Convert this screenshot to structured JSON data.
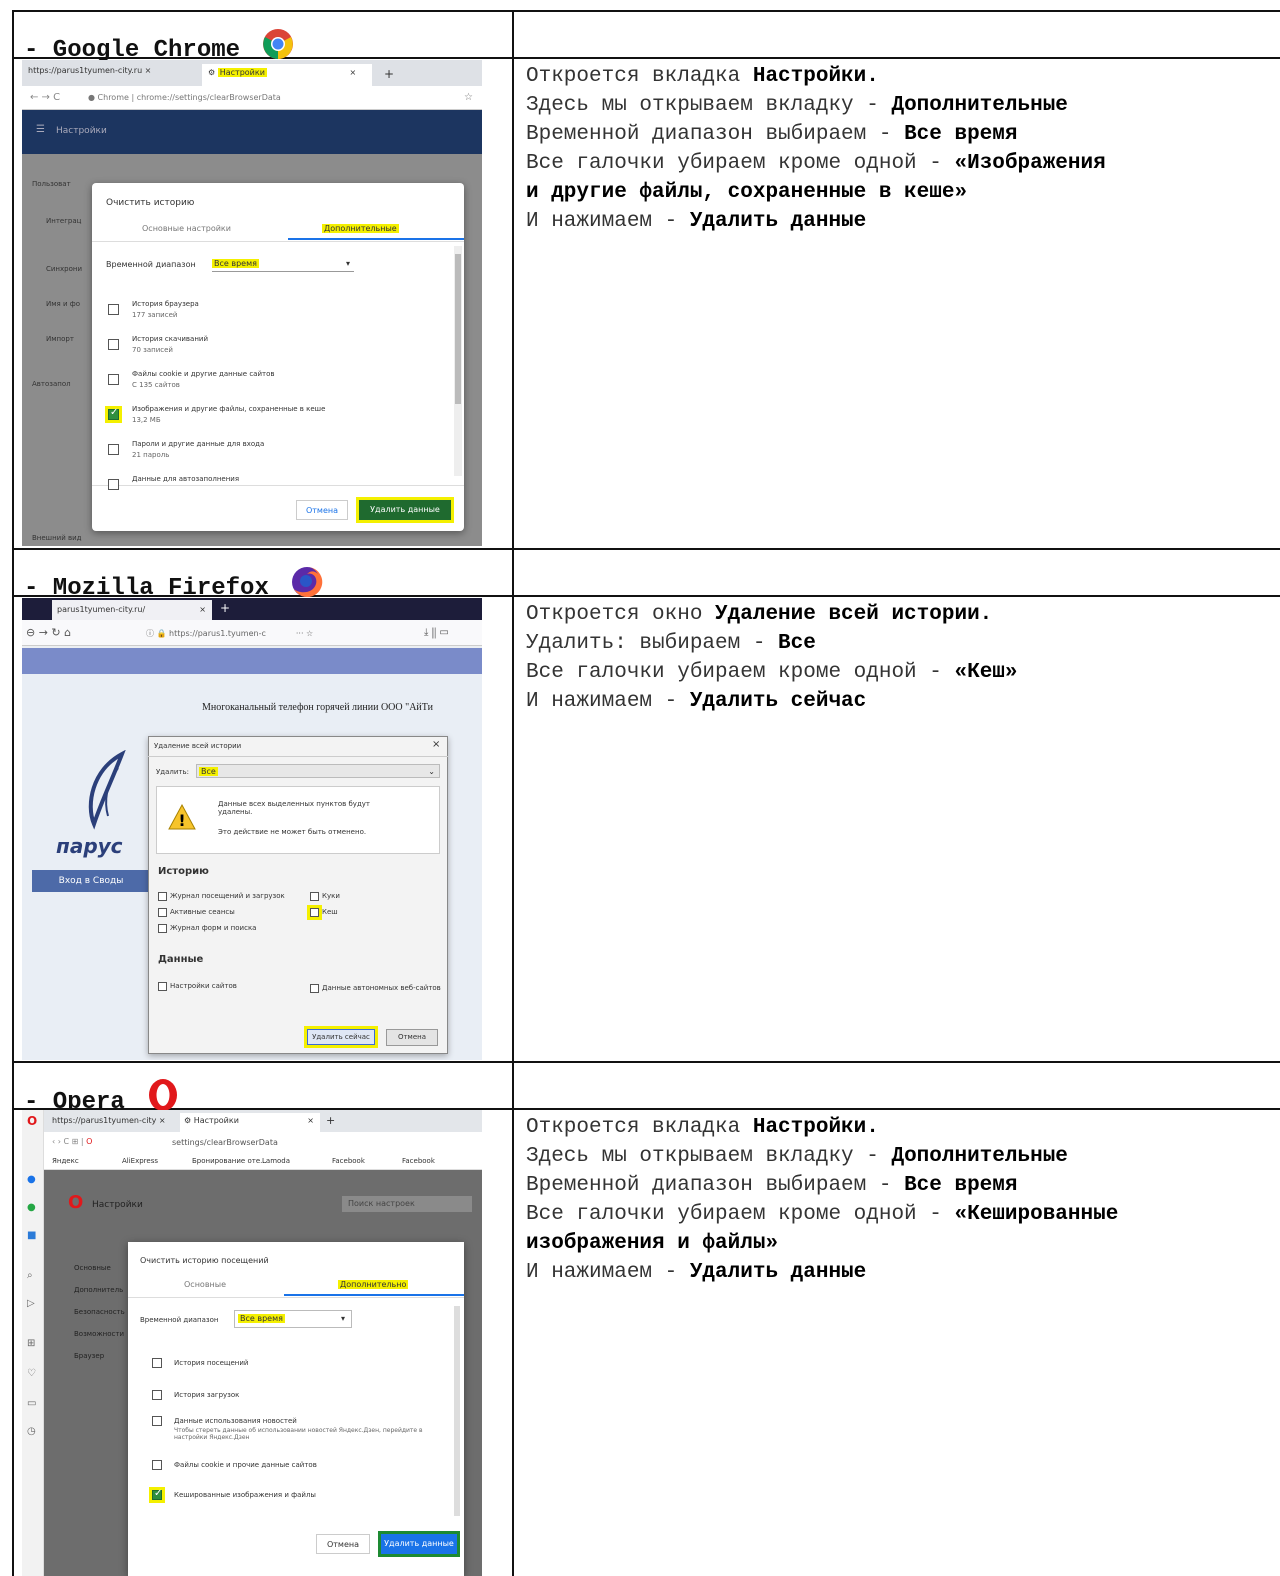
{
  "sections": [
    {
      "browser": "- Google Chrome",
      "logo_icon": "chrome-logo-icon",
      "instructions": [
        [
          {
            "t": "Откроется вкладка "
          },
          {
            "t": "Настройки.",
            "b": true
          }
        ],
        [
          {
            "t": "Здесь мы открываем вкладку - "
          },
          {
            "t": "Дополнительные",
            "b": true
          }
        ],
        [
          {
            "t": "Временной диапазон выбираем - "
          },
          {
            "t": "Все время",
            "b": true
          }
        ],
        [
          {
            "t": "Все галочки убираем кроме одной - "
          },
          {
            "t": "«Изображения",
            "b": true
          }
        ],
        [
          {
            "t": "и другие файлы, сохраненные в кеше»",
            "b": true
          }
        ],
        [
          {
            "t": "И нажимаем - "
          },
          {
            "t": "Удалить данные",
            "b": true
          }
        ]
      ]
    },
    {
      "browser": "- Mozilla Firefox",
      "logo_icon": "firefox-logo-icon",
      "instructions": [
        [
          {
            "t": "Откроется окно "
          },
          {
            "t": "Удаление всей истории.",
            "b": true
          }
        ],
        [
          {
            "t": "Удалить: выбираем - "
          },
          {
            "t": "Все",
            "b": true
          }
        ],
        [
          {
            "t": "Все галочки убираем кроме одной - "
          },
          {
            "t": "«Кеш»",
            "b": true
          }
        ],
        [
          {
            "t": "И нажимаем - "
          },
          {
            "t": "Удалить сейчас",
            "b": true
          }
        ]
      ]
    },
    {
      "browser": "- Opera",
      "logo_icon": "opera-logo-icon",
      "instructions": [
        [
          {
            "t": "Откроется вкладка "
          },
          {
            "t": "Настройки.",
            "b": true
          }
        ],
        [
          {
            "t": "Здесь мы открываем вкладку - "
          },
          {
            "t": "Дополнительные",
            "b": true
          }
        ],
        [
          {
            "t": "Временной диапазон выбираем - "
          },
          {
            "t": "Все время",
            "b": true
          }
        ],
        [
          {
            "t": "Все галочки убираем кроме одной - "
          },
          {
            "t": "«Кешированные",
            "b": true
          }
        ],
        [
          {
            "t": "изображения и файлы»",
            "b": true
          }
        ],
        [
          {
            "t": "И нажимаем - "
          },
          {
            "t": "Удалить данные",
            "b": true
          }
        ]
      ]
    }
  ],
  "chrome_shot": {
    "tab1": "https://parus1tyumen-city.ru",
    "tab2": "Настройки",
    "url": "Chrome | chrome://settings/clearBrowserData",
    "header": "Настройки",
    "dialog_title": "Очистить историю",
    "tab_basic": "Основные настройки",
    "tab_advanced": "Дополнительные",
    "range_label": "Временной диапазон",
    "range_value": "Все время",
    "items": [
      {
        "title": "История браузера",
        "sub": "177 записей",
        "checked": false
      },
      {
        "title": "История скачиваний",
        "sub": "70 записей",
        "checked": false
      },
      {
        "title": "Файлы cookie и другие данные сайтов",
        "sub": "С 135 сайтов",
        "checked": false
      },
      {
        "title": "Изображения и другие файлы, сохраненные в кеше",
        "sub": "13,2 МБ",
        "checked": true
      },
      {
        "title": "Пароли и другие данные для входа",
        "sub": "21 пароль",
        "checked": false
      },
      {
        "title": "Данные для автозаполнения",
        "sub": "",
        "checked": false
      }
    ],
    "cancel": "Отмена",
    "delete": "Удалить данные",
    "bg_labels": [
      "Пользоват",
      "Интеграц",
      "Синхрони",
      "Имя и фо",
      "Импорт",
      "Автозапол",
      "Внешний вид"
    ]
  },
  "firefox_shot": {
    "tab": "parus1tyumen-city.ru/",
    "url": "https://parus1.tyumen-c",
    "page_heading": "Многоканальный телефон горячей линии ООО \"АйТи",
    "brand": "парус",
    "login_btn": "Вход в Своды",
    "dialog_title": "Удаление всей истории",
    "remove_label": "Удалить:",
    "remove_value": "Все",
    "warning1": "Данные всех выделенных пунктов будут удалены.",
    "warning2": "Это действие не может быть отменено.",
    "history_title": "Историю",
    "history_items": [
      {
        "label": "Журнал посещений и загрузок",
        "checked": false
      },
      {
        "label": "Куки",
        "checked": false
      },
      {
        "label": "Активные сеансы",
        "checked": false
      },
      {
        "label": "Кеш",
        "checked": true
      },
      {
        "label": "Журнал форм и поиска",
        "checked": false
      }
    ],
    "data_title": "Данные",
    "data_items": [
      {
        "label": "Настройки сайтов",
        "checked": false
      },
      {
        "label": "Данные автономных веб-сайтов",
        "checked": false
      }
    ],
    "delete_now": "Удалить сейчас",
    "cancel": "Отмена"
  },
  "opera_shot": {
    "tab1": "https://parus1tyumen-city",
    "tab2": "Настройки",
    "url": "settings/clearBrowserData",
    "bookmarks": [
      "Яндекс",
      "AliExpress",
      "Бронирование оте...",
      "Lamoda",
      "Facebook",
      "Facebook"
    ],
    "header": "Настройки",
    "search_placeholder": "Поиск настроек",
    "side_items": [
      "Основные",
      "Дополнитель",
      "Безопасность",
      "Возможности",
      "Браузер"
    ],
    "dialog_title": "Очистить историю посещений",
    "tab_basic": "Основные",
    "tab_advanced": "Дополнительно",
    "range_label": "Временной диапазон",
    "range_value": "Все время",
    "items": [
      {
        "title": "История посещений",
        "sub": "",
        "checked": false
      },
      {
        "title": "История загрузок",
        "sub": "",
        "checked": false
      },
      {
        "title": "Данные использования новостей",
        "sub": "Чтобы стереть данные об использовании новостей Яндекс.Дзен, перейдите в настройки Яндекс.Дзен",
        "checked": false
      },
      {
        "title": "Файлы cookie и прочие данные сайтов",
        "sub": "",
        "checked": false
      },
      {
        "title": "Кешированные изображения и файлы",
        "sub": "",
        "checked": true
      }
    ],
    "cancel": "Отмена",
    "delete": "Удалить данные"
  }
}
